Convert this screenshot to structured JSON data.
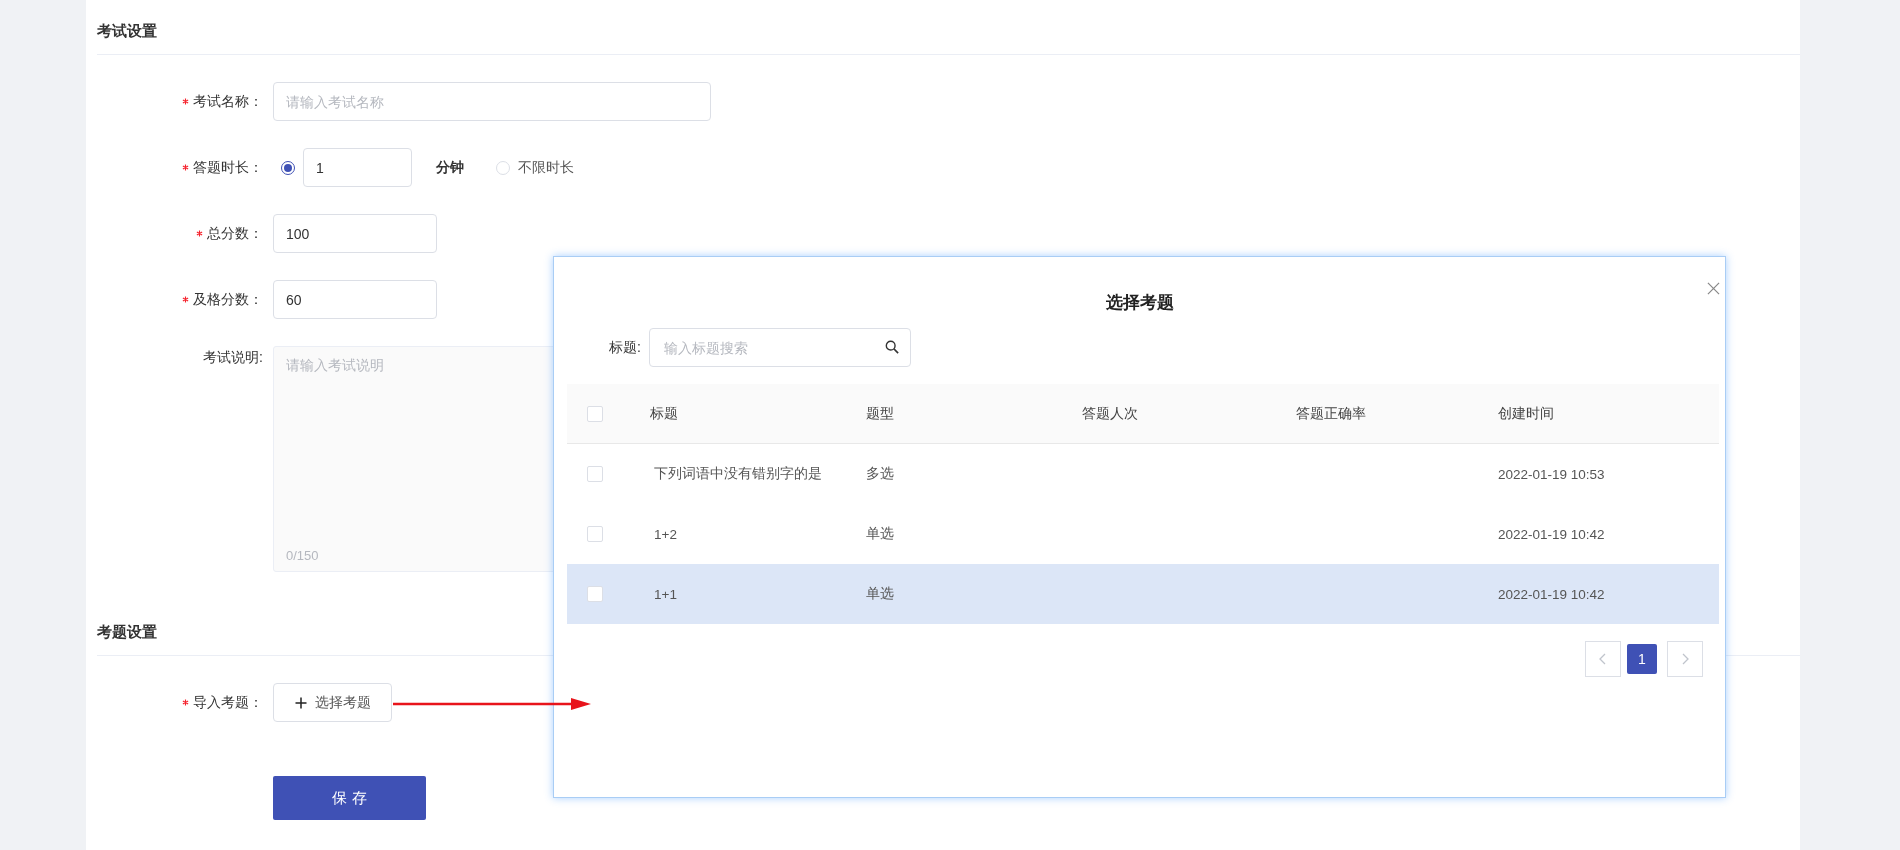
{
  "exam_settings": {
    "title": "考试设置",
    "fields": [
      {
        "kind": "text",
        "label": "考试名称：",
        "required": true,
        "placeholder": "请输入考试名称"
      },
      {
        "kind": "duration",
        "label": "答题时长：",
        "required": true,
        "options": [
          {
            "selected": true,
            "value": "1",
            "unit": "分钟"
          },
          {
            "selected": false,
            "label": "不限时长"
          }
        ]
      },
      {
        "kind": "short",
        "label": "总分数：",
        "required": true,
        "value": "100"
      },
      {
        "kind": "short",
        "label": "及格分数：",
        "required": true,
        "value": "60"
      },
      {
        "kind": "textarea",
        "label": "考试说明:",
        "required": false,
        "placeholder": "请输入考试说明",
        "counter": "0/150"
      }
    ]
  },
  "question_settings": {
    "title": "考题设置",
    "fields": [
      {
        "kind": "picker",
        "label": "导入考题：",
        "required": true,
        "button": "选择考题"
      }
    ]
  },
  "save_button": "保 存",
  "dialog": {
    "title": "选择考题",
    "search": {
      "label": "标题:",
      "placeholder": "输入标题搜索"
    },
    "table": {
      "all_checked": false,
      "columns": [
        "标题",
        "题型",
        "答题人次",
        "答题正确率",
        "创建时间"
      ],
      "rows": [
        {
          "checked": false,
          "highlighted": false,
          "title": "下列词语中没有错别字的是",
          "type": "多选",
          "created": "2022-01-19 10:53"
        },
        {
          "checked": false,
          "highlighted": false,
          "title": "1+2",
          "type": "单选",
          "created": "2022-01-19 10:42"
        },
        {
          "checked": false,
          "highlighted": true,
          "title": "1+1",
          "type": "单选",
          "created": "2022-01-19 10:42"
        }
      ]
    },
    "pagination": {
      "pages": [
        {
          "label": "1",
          "selected": true
        }
      ]
    }
  }
}
